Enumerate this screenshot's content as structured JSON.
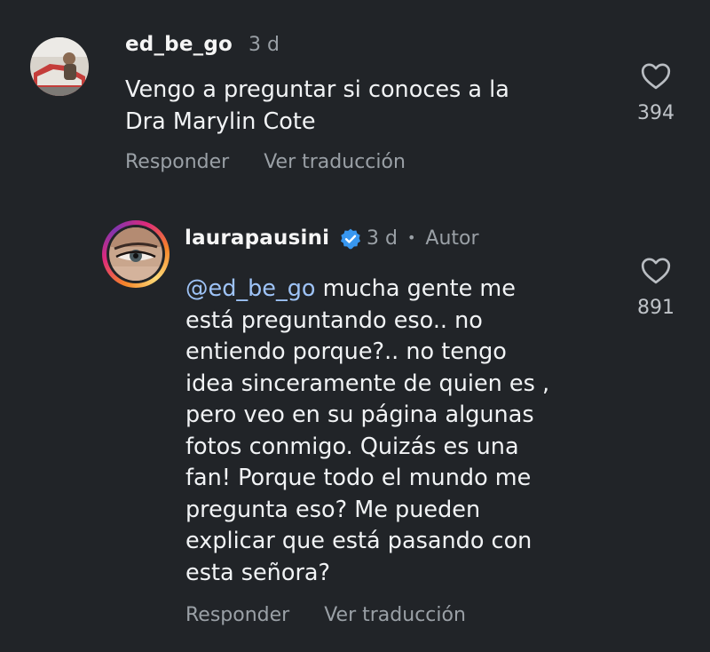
{
  "comments": [
    {
      "username": "ed_be_go",
      "time": "3 d",
      "lines": [
        "Vengo a preguntar si conoces a la",
        "Dra Marylin Cote"
      ],
      "reply_label": "Responder",
      "translate_label": "Ver traducción",
      "likes": "394",
      "avatar_icon": "user-photo-avatar"
    },
    {
      "username": "laurapausini",
      "verified": true,
      "time": "3 d",
      "separator": "•",
      "author_badge": "Autor",
      "mention": "@ed_be_go",
      "first_line_rest": " mucha gente me",
      "lines": [
        "está preguntando eso.. no",
        "entiendo porque?.. no tengo",
        "idea sinceramente de quien es ,",
        "pero veo en su página algunas",
        "fotos conmigo. Quizás es una",
        "fan! Porque todo el mundo me",
        "pregunta eso? Me pueden",
        "explicar que está pasando con",
        "esta señora?"
      ],
      "reply_label": "Responder",
      "translate_label": "Ver traducción",
      "likes": "891",
      "avatar_icon": "eye-photo-avatar",
      "accent": "#9ec3f7",
      "verified_color": "#3897f0"
    }
  ]
}
